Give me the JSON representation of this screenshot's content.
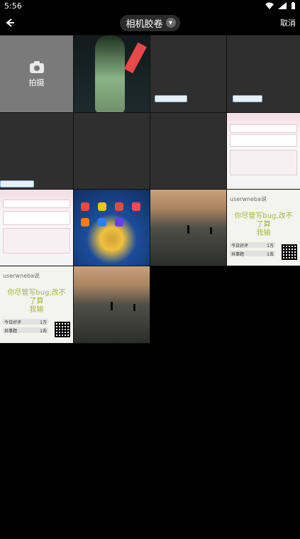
{
  "status_bar": {
    "time": "5:56"
  },
  "top_bar": {
    "title": "相机胶卷",
    "cancel": "取消"
  },
  "camera_tile": {
    "label": "拍摄"
  },
  "meme": {
    "username": "userwneba说",
    "text": "你尽管写bug,改不了算\n我输",
    "stat_label_1": "今日好评",
    "stat_val_1": "1万",
    "stat_label_2": "共事题",
    "stat_val_2": "1去"
  },
  "colors": {
    "background": "#000000",
    "tile_gray": "#7a7a7a",
    "accent_red": "#e84949"
  }
}
